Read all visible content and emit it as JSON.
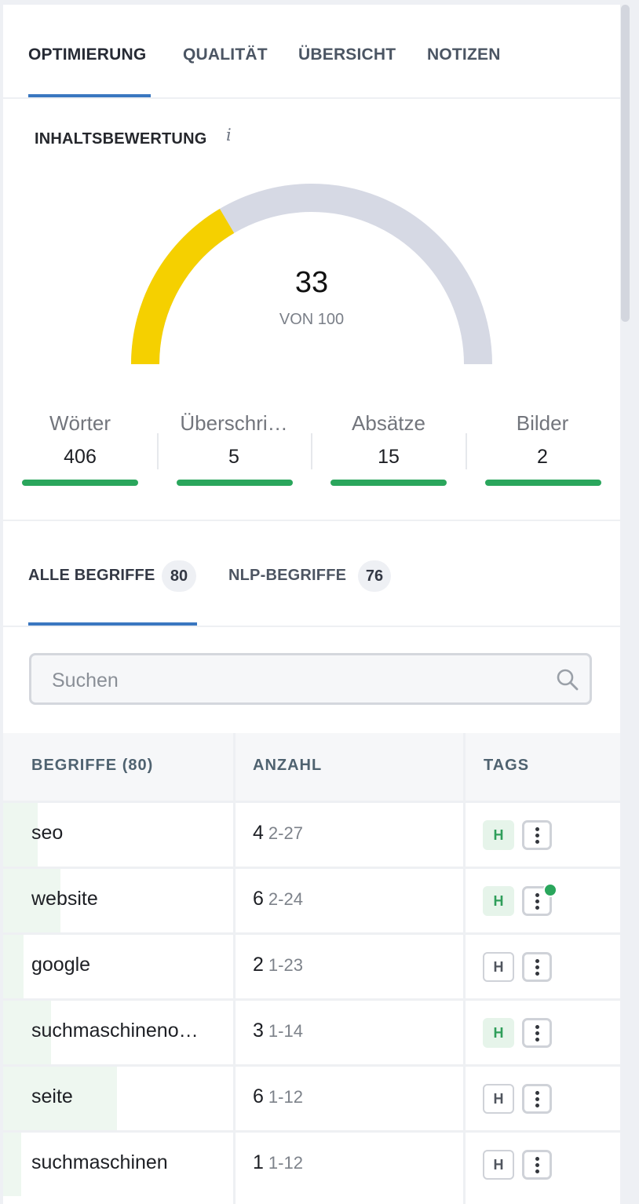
{
  "tabs": [
    {
      "label": "OPTIMIERUNG",
      "active": true
    },
    {
      "label": "QUALITÄT",
      "active": false
    },
    {
      "label": "ÜBERSICHT",
      "active": false
    },
    {
      "label": "NOTIZEN",
      "active": false
    }
  ],
  "content_score": {
    "title": "INHALTSBEWERTUNG",
    "info_glyph": "i",
    "value": "33",
    "max_label": "VON 100",
    "fraction": 0.33,
    "fill_color": "#f5d000",
    "track_color": "#d6d9e4"
  },
  "stats": [
    {
      "label": "Wörter",
      "value": "406",
      "status": "good"
    },
    {
      "label": "Überschri…",
      "value": "5",
      "status": "good"
    },
    {
      "label": "Absätze",
      "value": "15",
      "status": "good"
    },
    {
      "label": "Bilder",
      "value": "2",
      "status": "good"
    }
  ],
  "term_tabs": [
    {
      "label": "ALLE BEGRIFFE",
      "count": "80",
      "active": true
    },
    {
      "label": "NLP-BEGRIFFE",
      "count": "76",
      "active": false
    }
  ],
  "search": {
    "placeholder": "Suchen",
    "value": "",
    "icon": "search-icon"
  },
  "table": {
    "headers": {
      "terms": "BEGRIFFE",
      "terms_count": "(80)",
      "count": "ANZAHL",
      "tags": "TAGS"
    },
    "rows": [
      {
        "term": "seo",
        "count": "4",
        "range": "2-27",
        "tag_h": "H",
        "tag_active": true,
        "progress": 0.15,
        "notify": false
      },
      {
        "term": "website",
        "count": "6",
        "range": "2-24",
        "tag_h": "H",
        "tag_active": true,
        "progress": 0.25,
        "notify": true
      },
      {
        "term": "google",
        "count": "2",
        "range": "1-23",
        "tag_h": "H",
        "tag_active": false,
        "progress": 0.09,
        "notify": false
      },
      {
        "term": "suchmaschineno…",
        "count": "3",
        "range": "1-14",
        "tag_h": "H",
        "tag_active": true,
        "progress": 0.21,
        "notify": false
      },
      {
        "term": "seite",
        "count": "6",
        "range": "1-12",
        "tag_h": "H",
        "tag_active": false,
        "progress": 0.5,
        "notify": false
      },
      {
        "term": "suchmaschinen",
        "count": "1",
        "range": "1-12",
        "tag_h": "H",
        "tag_active": false,
        "progress": 0.08,
        "notify": false
      }
    ]
  },
  "colors": {
    "accent": "#3a77c0",
    "good": "#2aa65c"
  }
}
